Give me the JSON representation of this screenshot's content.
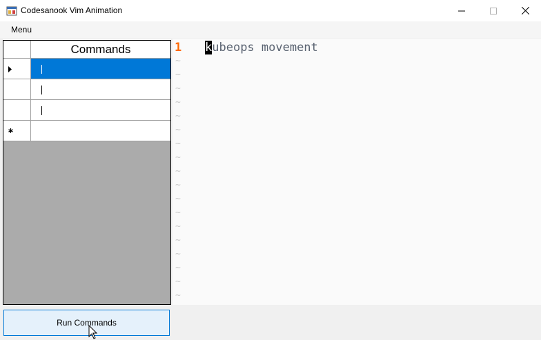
{
  "window": {
    "title": "Codesanook Vim Animation",
    "controls": [
      "minimize",
      "maximize",
      "close"
    ]
  },
  "menu": {
    "items": [
      "Menu"
    ]
  },
  "commands_grid": {
    "column_header": "Commands",
    "rows": [
      {
        "value": "",
        "selected": true,
        "row_indicator": "current-row-arrow"
      },
      {
        "value": "",
        "selected": false,
        "row_indicator": ""
      },
      {
        "value": "",
        "selected": false,
        "row_indicator": ""
      },
      {
        "value": "",
        "selected": false,
        "row_indicator": "new-row-asterisk"
      }
    ],
    "background_color": "#ababab",
    "selection_color": "#0078d7"
  },
  "editor": {
    "line_number": "1",
    "cursor_char": "k",
    "line_rest": "ubeops movement",
    "tilde": "~",
    "line_number_color": "#ff6a00",
    "text_color": "#5a6371"
  },
  "run_button": {
    "label": "Run Commands"
  }
}
